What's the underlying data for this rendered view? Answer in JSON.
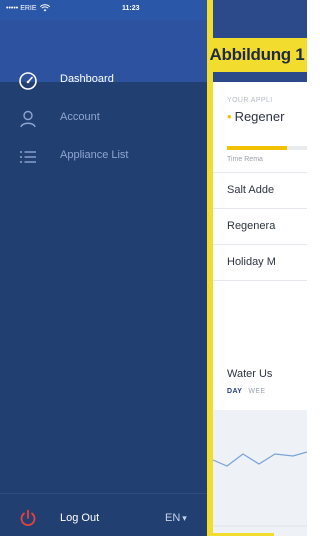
{
  "status_bar": {
    "carrier": "••••• ERIE",
    "time": "11:23"
  },
  "figure_label": "Abbildung 1",
  "menu": {
    "items": [
      {
        "label": "Dashboard",
        "icon": "gauge-icon",
        "active": true
      },
      {
        "label": "Account",
        "icon": "user-icon",
        "active": false
      },
      {
        "label": "Appliance List",
        "icon": "list-icon",
        "active": false
      }
    ],
    "logout_label": "Log Out",
    "language": "EN"
  },
  "background_app": {
    "card_caption": "YOUR APPLI",
    "status_text": "Regener",
    "progress_fraction": 0.75,
    "time_remaining_label": "Time Rema",
    "rows": [
      "Salt Adde",
      "Regenera",
      "Holiday M"
    ],
    "water_title": "Water Us",
    "tabs": [
      "DAY",
      "WEE"
    ]
  },
  "colors": {
    "drawer_bg": "#223f72",
    "drawer_header": "#2c52a0",
    "accent_yellow": "#f2dd2e",
    "logout_red": "#e8423a"
  }
}
